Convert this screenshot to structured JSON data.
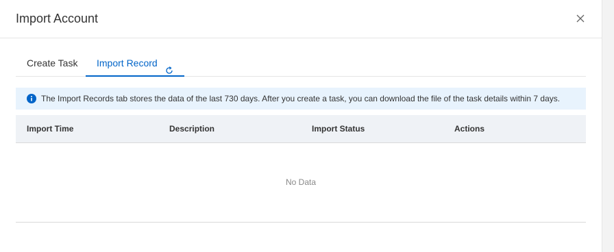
{
  "dialog": {
    "title": "Import Account",
    "close_icon": "close-icon"
  },
  "tabs": [
    {
      "label": "Create Task",
      "active": false
    },
    {
      "label": "Import Record",
      "active": true,
      "icon": "refresh-icon"
    }
  ],
  "notice": {
    "icon": "info-icon",
    "text": "The Import Records tab stores the data of the last 730 days. After you create a task, you can download the file of the task details within 7 days."
  },
  "table": {
    "columns": [
      "Import Time",
      "Description",
      "Import Status",
      "Actions"
    ],
    "rows": [],
    "empty_text": "No Data"
  },
  "colors": {
    "accent": "#0064c8",
    "notice_bg": "#e8f3fd",
    "header_bg": "#eff2f6"
  }
}
